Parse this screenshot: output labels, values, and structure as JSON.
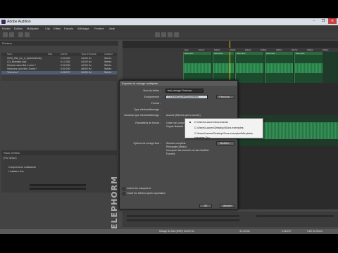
{
  "window": {
    "title": "Adobe Audition",
    "controls": [
      "–",
      "❐",
      "✕"
    ]
  },
  "menu": [
    "Fichier",
    "Edition",
    "Multipiste",
    "Clip",
    "Effets",
    "Favoris",
    "Affichage",
    "Fenêtre",
    "Aide"
  ],
  "files_panel": {
    "title": "Fichiers",
    "columns": [
      "Nom",
      "Etat",
      "Durée",
      "Taux d'échant.",
      "Canaux"
    ],
    "rows": [
      {
        "name": "2015_03b_sin_0_fadeOutDelay",
        "duration": "0:00,000",
        "rate": "44100 Hz",
        "channels": "Stéréo"
      },
      {
        "name": "CD_Bremabr.wav",
        "duration": "0:12,082",
        "rate": "44100 Hz",
        "channels": "Stéréo"
      },
      {
        "name": "Session sans titre 1.sesx *",
        "duration": "0:00,000",
        "rate": "44100 Hz",
        "channels": "Stéréo"
      },
      {
        "name": "Sessions sans titre 3.sesx *",
        "duration": "0:00,000",
        "rate": "48000 Hz",
        "channels": "Stéréo"
      },
      {
        "name": "Test.sesx *",
        "duration": "4:08,227",
        "rate": "44100 Hz",
        "channels": "Stéréo"
      }
    ]
  },
  "effects_panel": {
    "title": "Rack d'effets",
    "preset": "(Par défaut)",
    "items": [
      "Compresseur multibande",
      "Limitateur fixe"
    ]
  },
  "dialog": {
    "title": "Exporter le mixage multipiste",
    "file_name_label": "Nom de fichier :",
    "file_name_value": "test_mixage Final.wav",
    "location_label": "Emplacement :",
    "location_value": "C:\\Users\\Lauren\\Documents",
    "browse_button": "Parcourir...",
    "format_label": "Format :",
    "sample_type_label": "Type d'échantillonnage :",
    "new_sample_type_label": "Nouveau type d'échantillonnage :",
    "new_sample_type_value": "Aucune (Mêmes que la source)",
    "format_params_label": "Paramètres de format :",
    "format_params_line1": "Onde non compressée",
    "format_params_line2": "Virgule flottante 32 bits (IEEE)",
    "modify_button_1": "Modifier...",
    "mix_options_label": "Options de mixage final :",
    "mix_options_line1": "Session complète",
    "mix_options_line2": "Principale (Stéréo)",
    "mix_options_line3": "Incorporer les données du fant Modifier",
    "mix_options_line4": "Forcées",
    "modify_button_2": "Modifier...",
    "checkbox_markers": "Inclure les marques et",
    "checkbox_open": "Ouvrir les fichiers après exportation",
    "ok_button": "OK",
    "cancel_button": "Annuler"
  },
  "location_dropdown": {
    "options": [
      "C:\\Users\\Lauren\\Documents",
      "C:\\Users\\Lauren\\Desktop\\Sons exemples",
      "C:\\Users\\Lauren\\Desktop\\Sons exemples\\Mis pistes séparées Dru"
    ],
    "selected_index": 0
  },
  "timeline": {
    "ruler_labels": [
      "hms",
      "0:01,0",
      "0:02,0",
      "0:03,0",
      "0:04,0",
      "0:05,0",
      "0:06,0",
      "0:07,0",
      "0:08,0",
      "0:09,0"
    ],
    "clips": [
      "Test.sesx",
      "Test.sesx",
      "Test.sesx",
      "Test.sesx",
      "Test.sesx"
    ]
  },
  "status": {
    "left": "Mixage 32 bits (IEEE) 44100 Hz",
    "mid": "42,44 Mo",
    "time": "4:08,227",
    "disk": "3,80 Go libres"
  },
  "watermark": "ELEPHORM"
}
